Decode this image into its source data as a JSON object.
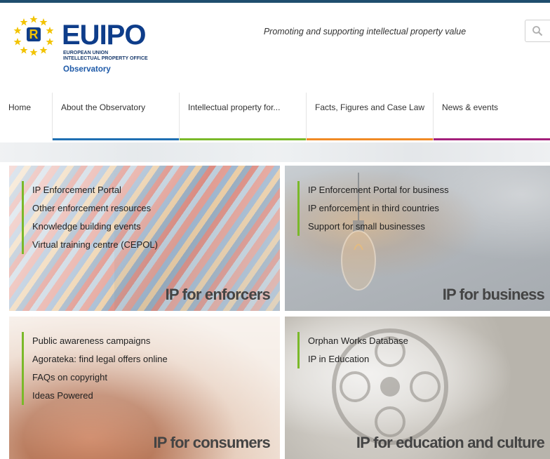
{
  "header": {
    "logo": {
      "wordmark": "EUIPO",
      "subtitle_line1": "EUROPEAN UNION",
      "subtitle_line2": "INTELLECTUAL PROPERTY OFFICE",
      "observatory": "Observatory"
    },
    "tagline": "Promoting and supporting intellectual property value",
    "search_icon": "search-icon"
  },
  "nav": {
    "items": [
      {
        "label": "Home",
        "color": "#ffffff"
      },
      {
        "label": "About the Observatory",
        "color": "#1f6fb2"
      },
      {
        "label": "Intellectual property for...",
        "color": "#7ab929"
      },
      {
        "label": "Facts, Figures and Case Law",
        "color": "#f08a24"
      },
      {
        "label": "News & events",
        "color": "#a3207b"
      }
    ]
  },
  "tiles": [
    {
      "heading": "IP for enforcers",
      "links": [
        "IP Enforcement Portal",
        "Other enforcement resources",
        "Knowledge building events",
        "Virtual training centre (CEPOL)"
      ]
    },
    {
      "heading": "IP for business",
      "links": [
        "IP Enforcement Portal for business",
        "IP enforcement in third countries",
        "Support for small businesses"
      ]
    },
    {
      "heading": "IP for consumers",
      "links": [
        "Public awareness campaigns",
        "Agorateka: find legal offers online",
        "FAQs on copyright",
        "Ideas Powered"
      ]
    },
    {
      "heading": "IP for education and culture",
      "links": [
        "Orphan Works Database",
        "IP in Education"
      ]
    }
  ],
  "colors": {
    "accent_green": "#7ab929",
    "brand_blue": "#0e3d8a"
  }
}
